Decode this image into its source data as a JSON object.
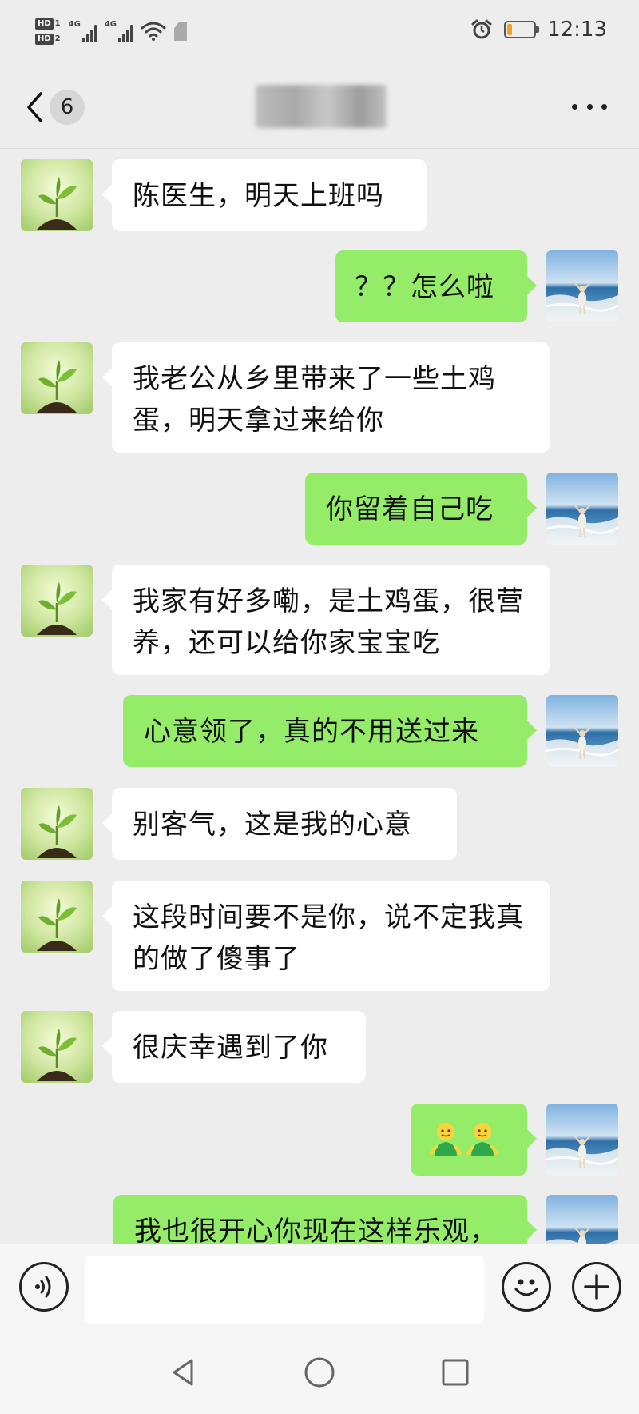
{
  "status_bar": {
    "sim1": "HD",
    "sim1_num": "1",
    "sim2": "HD",
    "sim2_num": "2",
    "net1": "4G",
    "net2": "4G",
    "time": "12:13",
    "battery_level_percent": 20,
    "icons": [
      "signal-icon",
      "wifi-icon",
      "alarm-icon",
      "battery-icon"
    ]
  },
  "title_bar": {
    "unread_count": "6",
    "title_obscured": true,
    "icons": [
      "back-chevron-icon",
      "more-icon"
    ]
  },
  "messages": [
    {
      "side": "in",
      "text": "陈医生，明天上班吗"
    },
    {
      "side": "out",
      "text": "？？怎么啦"
    },
    {
      "side": "in",
      "text": "我老公从乡里带来了一些土鸡蛋，明天拿过来给你"
    },
    {
      "side": "out",
      "text": "你留着自己吃"
    },
    {
      "side": "in",
      "text": "我家有好多嘞，是土鸡蛋，很营养，还可以给你家宝宝吃"
    },
    {
      "side": "out",
      "text": "心意领了，真的不用送过来"
    },
    {
      "side": "in",
      "text": "别客气，这是我的心意"
    },
    {
      "side": "in",
      "text": "这段时间要不是你，说不定我真的做了傻事了"
    },
    {
      "side": "in",
      "text": "很庆幸遇到了你"
    },
    {
      "side": "out",
      "text": "",
      "emoji": [
        "smiling-person-emoji",
        "smiling-person-emoji"
      ]
    },
    {
      "side": "out",
      "text": "我也很开心你现在这样乐观，"
    }
  ],
  "input_bar": {
    "placeholder": "",
    "icons": [
      "voice-icon",
      "emoji-icon",
      "plus-icon"
    ]
  },
  "nav_bar": {
    "icons": [
      "nav-back-icon",
      "nav-home-icon",
      "nav-recents-icon"
    ]
  },
  "colors": {
    "background": "#ededed",
    "bubble_out": "#95ec69",
    "bubble_in": "#ffffff"
  }
}
